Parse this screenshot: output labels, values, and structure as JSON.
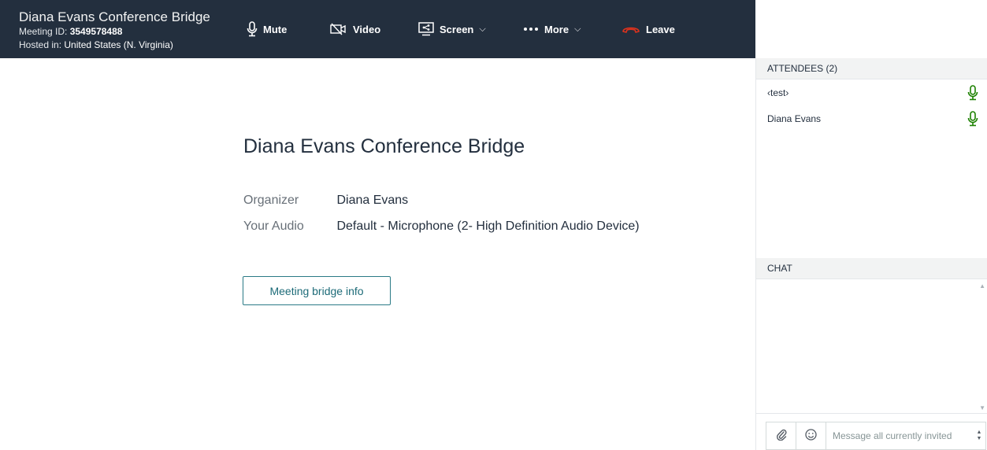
{
  "meeting": {
    "title": "Diana Evans Conference Bridge",
    "id_label": "Meeting ID:",
    "id_value": "3549578488",
    "hosted_label": "Hosted in:",
    "hosted_value": "United States (N. Virginia)"
  },
  "toolbar": {
    "mute_label": "Mute",
    "video_label": "Video",
    "screen_label": "Screen",
    "more_label": "More",
    "leave_label": "Leave",
    "chevron": "⌵"
  },
  "main": {
    "title": "Diana Evans Conference Bridge",
    "organizer_label": "Organizer",
    "organizer_value": "Diana Evans",
    "audio_label": "Your Audio",
    "audio_value": "Default - Microphone (2- High Definition Audio Device)",
    "bridge_button": "Meeting bridge info"
  },
  "attendees": {
    "header": "ATTENDEES (2)",
    "items": [
      {
        "name": "‹test›"
      },
      {
        "name": "Diana Evans"
      }
    ]
  },
  "chat": {
    "header": "CHAT",
    "placeholder": "Message all currently invited"
  },
  "colors": {
    "topbar": "#232f3e",
    "leave_red": "#d13212",
    "mic_teal": "#1d8102",
    "accent_teal": "#2a7a86"
  },
  "icons": [
    "mic-icon",
    "video-off-icon",
    "screen-share-icon",
    "more-dots-icon",
    "phone-hangup-icon",
    "attendee-mic-icon",
    "paperclip-icon",
    "emoji-icon"
  ]
}
